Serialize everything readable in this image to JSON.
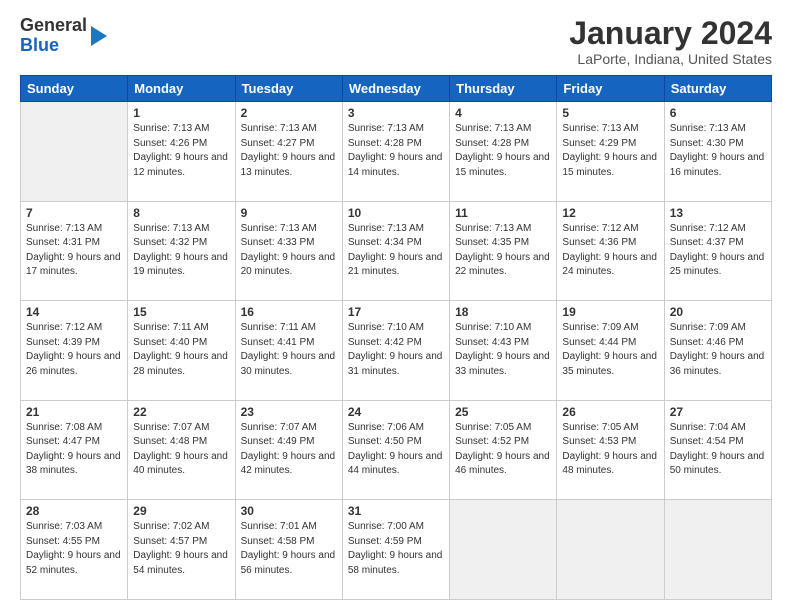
{
  "header": {
    "logo_line1": "General",
    "logo_line2": "Blue",
    "main_title": "January 2024",
    "subtitle": "LaPorte, Indiana, United States"
  },
  "weekdays": [
    "Sunday",
    "Monday",
    "Tuesday",
    "Wednesday",
    "Thursday",
    "Friday",
    "Saturday"
  ],
  "weeks": [
    [
      {
        "day": "",
        "empty": true
      },
      {
        "day": "1",
        "sunrise": "7:13 AM",
        "sunset": "4:26 PM",
        "daylight": "9 hours and 12 minutes."
      },
      {
        "day": "2",
        "sunrise": "7:13 AM",
        "sunset": "4:27 PM",
        "daylight": "9 hours and 13 minutes."
      },
      {
        "day": "3",
        "sunrise": "7:13 AM",
        "sunset": "4:28 PM",
        "daylight": "9 hours and 14 minutes."
      },
      {
        "day": "4",
        "sunrise": "7:13 AM",
        "sunset": "4:28 PM",
        "daylight": "9 hours and 15 minutes."
      },
      {
        "day": "5",
        "sunrise": "7:13 AM",
        "sunset": "4:29 PM",
        "daylight": "9 hours and 15 minutes."
      },
      {
        "day": "6",
        "sunrise": "7:13 AM",
        "sunset": "4:30 PM",
        "daylight": "9 hours and 16 minutes."
      }
    ],
    [
      {
        "day": "7",
        "sunrise": "7:13 AM",
        "sunset": "4:31 PM",
        "daylight": "9 hours and 17 minutes."
      },
      {
        "day": "8",
        "sunrise": "7:13 AM",
        "sunset": "4:32 PM",
        "daylight": "9 hours and 19 minutes."
      },
      {
        "day": "9",
        "sunrise": "7:13 AM",
        "sunset": "4:33 PM",
        "daylight": "9 hours and 20 minutes."
      },
      {
        "day": "10",
        "sunrise": "7:13 AM",
        "sunset": "4:34 PM",
        "daylight": "9 hours and 21 minutes."
      },
      {
        "day": "11",
        "sunrise": "7:13 AM",
        "sunset": "4:35 PM",
        "daylight": "9 hours and 22 minutes."
      },
      {
        "day": "12",
        "sunrise": "7:12 AM",
        "sunset": "4:36 PM",
        "daylight": "9 hours and 24 minutes."
      },
      {
        "day": "13",
        "sunrise": "7:12 AM",
        "sunset": "4:37 PM",
        "daylight": "9 hours and 25 minutes."
      }
    ],
    [
      {
        "day": "14",
        "sunrise": "7:12 AM",
        "sunset": "4:39 PM",
        "daylight": "9 hours and 26 minutes."
      },
      {
        "day": "15",
        "sunrise": "7:11 AM",
        "sunset": "4:40 PM",
        "daylight": "9 hours and 28 minutes."
      },
      {
        "day": "16",
        "sunrise": "7:11 AM",
        "sunset": "4:41 PM",
        "daylight": "9 hours and 30 minutes."
      },
      {
        "day": "17",
        "sunrise": "7:10 AM",
        "sunset": "4:42 PM",
        "daylight": "9 hours and 31 minutes."
      },
      {
        "day": "18",
        "sunrise": "7:10 AM",
        "sunset": "4:43 PM",
        "daylight": "9 hours and 33 minutes."
      },
      {
        "day": "19",
        "sunrise": "7:09 AM",
        "sunset": "4:44 PM",
        "daylight": "9 hours and 35 minutes."
      },
      {
        "day": "20",
        "sunrise": "7:09 AM",
        "sunset": "4:46 PM",
        "daylight": "9 hours and 36 minutes."
      }
    ],
    [
      {
        "day": "21",
        "sunrise": "7:08 AM",
        "sunset": "4:47 PM",
        "daylight": "9 hours and 38 minutes."
      },
      {
        "day": "22",
        "sunrise": "7:07 AM",
        "sunset": "4:48 PM",
        "daylight": "9 hours and 40 minutes."
      },
      {
        "day": "23",
        "sunrise": "7:07 AM",
        "sunset": "4:49 PM",
        "daylight": "9 hours and 42 minutes."
      },
      {
        "day": "24",
        "sunrise": "7:06 AM",
        "sunset": "4:50 PM",
        "daylight": "9 hours and 44 minutes."
      },
      {
        "day": "25",
        "sunrise": "7:05 AM",
        "sunset": "4:52 PM",
        "daylight": "9 hours and 46 minutes."
      },
      {
        "day": "26",
        "sunrise": "7:05 AM",
        "sunset": "4:53 PM",
        "daylight": "9 hours and 48 minutes."
      },
      {
        "day": "27",
        "sunrise": "7:04 AM",
        "sunset": "4:54 PM",
        "daylight": "9 hours and 50 minutes."
      }
    ],
    [
      {
        "day": "28",
        "sunrise": "7:03 AM",
        "sunset": "4:55 PM",
        "daylight": "9 hours and 52 minutes."
      },
      {
        "day": "29",
        "sunrise": "7:02 AM",
        "sunset": "4:57 PM",
        "daylight": "9 hours and 54 minutes."
      },
      {
        "day": "30",
        "sunrise": "7:01 AM",
        "sunset": "4:58 PM",
        "daylight": "9 hours and 56 minutes."
      },
      {
        "day": "31",
        "sunrise": "7:00 AM",
        "sunset": "4:59 PM",
        "daylight": "9 hours and 58 minutes."
      },
      {
        "day": "",
        "empty": true
      },
      {
        "day": "",
        "empty": true
      },
      {
        "day": "",
        "empty": true
      }
    ]
  ],
  "labels": {
    "sunrise": "Sunrise:",
    "sunset": "Sunset:",
    "daylight": "Daylight:"
  }
}
